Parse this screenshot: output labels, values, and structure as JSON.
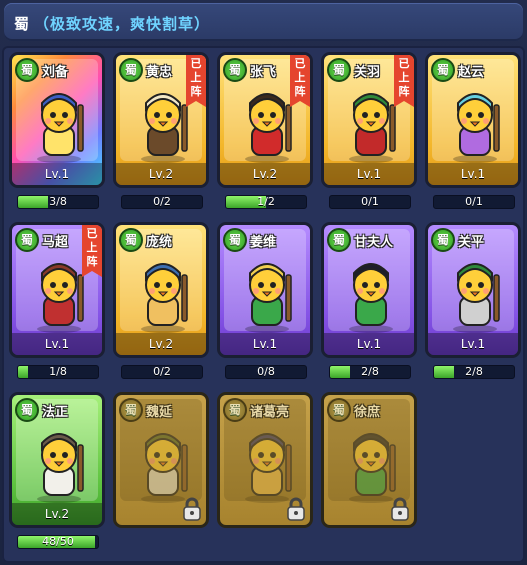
{
  "header": {
    "faction": "蜀",
    "subtitle": "（极致攻速，爽快割草）"
  },
  "heroes": [
    {
      "name": "刘备",
      "faction": "蜀",
      "level": "Lv.1",
      "progress": "3/8",
      "fill": 0.375,
      "deployed": false,
      "locked": false,
      "rarity": "rainbow",
      "hat": "#3b5fc4",
      "accent": "#ffe36a",
      "weapon": "staff"
    },
    {
      "name": "黄忠",
      "faction": "蜀",
      "level": "Lv.2",
      "progress": "0/2",
      "fill": 0,
      "deployed": true,
      "locked": false,
      "rarity": "gold",
      "hat": "#f2e8c8",
      "accent": "#6b4a2a",
      "weapon": "cannon"
    },
    {
      "name": "张飞",
      "faction": "蜀",
      "level": "Lv.2",
      "progress": "1/2",
      "fill": 0.5,
      "deployed": true,
      "locked": false,
      "rarity": "gold",
      "hat": "#3a2a1e",
      "accent": "#d12b2b",
      "weapon": "spear"
    },
    {
      "name": "关羽",
      "faction": "蜀",
      "level": "Lv.1",
      "progress": "0/1",
      "fill": 0,
      "deployed": true,
      "locked": false,
      "rarity": "gold",
      "hat": "#2f8a3a",
      "accent": "#c22a2a",
      "weapon": "blade"
    },
    {
      "name": "赵云",
      "faction": "蜀",
      "level": "Lv.1",
      "progress": "0/1",
      "fill": 0,
      "deployed": false,
      "locked": false,
      "rarity": "gold",
      "hat": "#66d0e0",
      "accent": "#b06be0",
      "weapon": "lance"
    },
    {
      "name": "马超",
      "faction": "蜀",
      "level": "Lv.1",
      "progress": "1/8",
      "fill": 0.125,
      "deployed": true,
      "locked": false,
      "rarity": "purple",
      "hat": "#8a3a2a",
      "accent": "#c03030",
      "weapon": "shield"
    },
    {
      "name": "庞统",
      "faction": "蜀",
      "level": "Lv.2",
      "progress": "0/2",
      "fill": 0,
      "deployed": false,
      "locked": false,
      "rarity": "gold",
      "hat": "#3e6fb0",
      "accent": "#f0c060",
      "weapon": "staff"
    },
    {
      "name": "姜维",
      "faction": "蜀",
      "level": "Lv.1",
      "progress": "0/8",
      "fill": 0,
      "deployed": false,
      "locked": false,
      "rarity": "purple",
      "hat": "#f0d050",
      "accent": "#3aa84a",
      "weapon": "bow"
    },
    {
      "name": "甘夫人",
      "faction": "蜀",
      "level": "Lv.1",
      "progress": "2/8",
      "fill": 0.25,
      "deployed": false,
      "locked": false,
      "rarity": "purple",
      "hat": "#1e1e2a",
      "accent": "#3aa84a",
      "weapon": "none"
    },
    {
      "name": "关平",
      "faction": "蜀",
      "level": "Lv.1",
      "progress": "2/8",
      "fill": 0.25,
      "deployed": false,
      "locked": false,
      "rarity": "purple",
      "hat": "#2f8a3a",
      "accent": "#d0d0d0",
      "weapon": "blade"
    },
    {
      "name": "法正",
      "faction": "蜀",
      "level": "Lv.2",
      "progress": "48/50",
      "fill": 0.96,
      "deployed": false,
      "locked": false,
      "rarity": "green",
      "hat": "#6a5a4a",
      "accent": "#f2f0ea",
      "weapon": "scroll"
    },
    {
      "name": "魏延",
      "faction": "蜀",
      "level": "",
      "progress": "",
      "fill": 0,
      "deployed": false,
      "locked": true,
      "rarity": "locked",
      "hat": "#5a6b2a",
      "accent": "#e6e2d0",
      "weapon": "axe"
    },
    {
      "name": "诸葛亮",
      "faction": "蜀",
      "level": "",
      "progress": "",
      "fill": 0,
      "deployed": false,
      "locked": true,
      "rarity": "locked",
      "hat": "#3a3a6a",
      "accent": "#f0c050",
      "weapon": "fan"
    },
    {
      "name": "徐庶",
      "faction": "蜀",
      "level": "",
      "progress": "",
      "fill": 0,
      "deployed": false,
      "locked": true,
      "rarity": "locked",
      "hat": "#2a2a2a",
      "accent": "#3aa84a",
      "weapon": "sword"
    }
  ],
  "ribbon_text": [
    "已",
    "上",
    "阵"
  ]
}
